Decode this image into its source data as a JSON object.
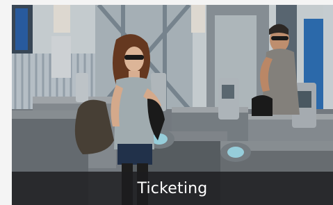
{
  "tile": {
    "caption": "Ticketing",
    "photo_subject": "fare-gate-photo"
  },
  "colors": {
    "caption_bar": "#1c1c1e",
    "caption_text": "#ffffff",
    "gate_body": "#6d7277",
    "reader_glow": "#9fd8e6"
  }
}
